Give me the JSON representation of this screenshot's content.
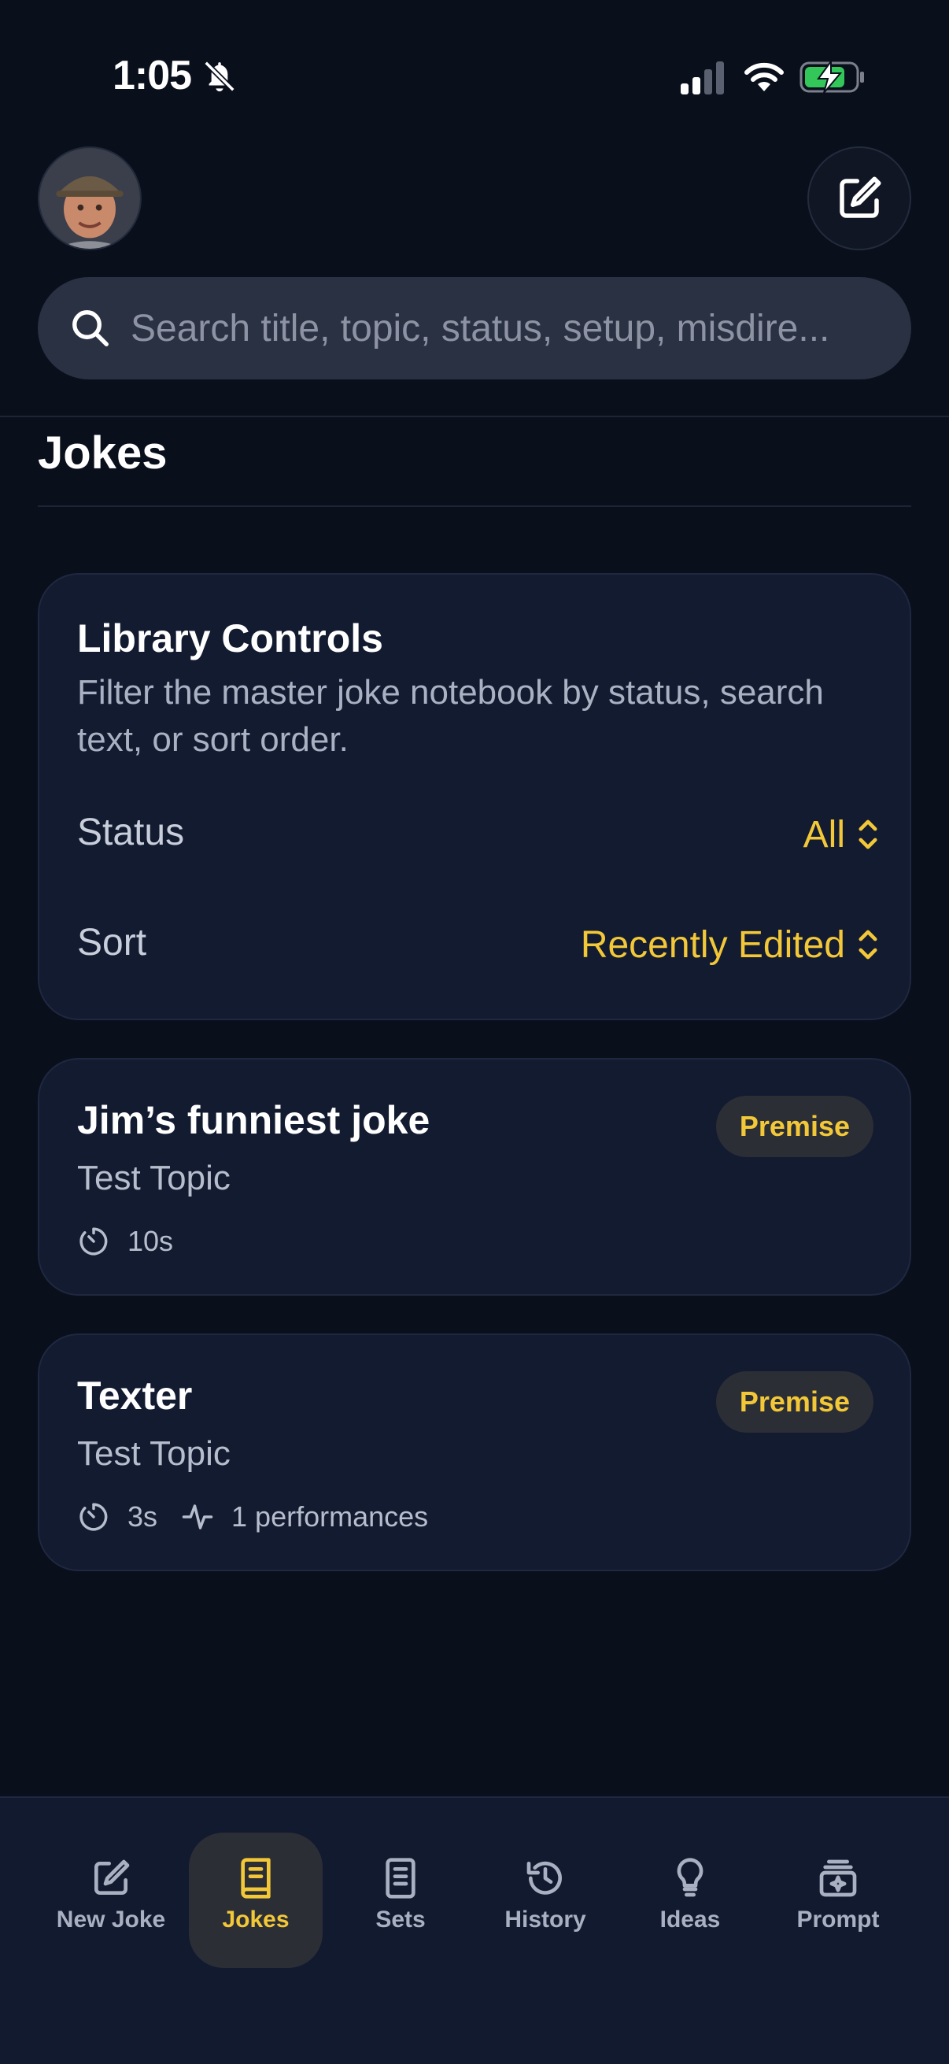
{
  "status_bar": {
    "time": "1:05"
  },
  "header": {
    "avatar_label": "profile-avatar"
  },
  "search": {
    "placeholder": "Search title, topic, status, setup, misdire..."
  },
  "page": {
    "title": "Jokes"
  },
  "library_controls": {
    "title": "Library Controls",
    "description": "Filter the master joke notebook by status, search text, or sort order.",
    "status_label": "Status",
    "status_value": "All",
    "sort_label": "Sort",
    "sort_value": "Recently Edited"
  },
  "jokes": [
    {
      "title": "Jim’s funniest joke",
      "topic": "Test Topic",
      "status": "Premise",
      "duration": "10s",
      "performances": null
    },
    {
      "title": "Texter",
      "topic": "Test Topic",
      "status": "Premise",
      "duration": "3s",
      "performances": "1 performances"
    }
  ],
  "tabs": [
    {
      "label": "New Joke",
      "icon": "compose-icon"
    },
    {
      "label": "Jokes",
      "icon": "book-icon",
      "active": true
    },
    {
      "label": "Sets",
      "icon": "list-doc-icon"
    },
    {
      "label": "History",
      "icon": "history-icon"
    },
    {
      "label": "Ideas",
      "icon": "lightbulb-icon"
    },
    {
      "label": "Prompt",
      "icon": "sparkle-stack-icon"
    }
  ],
  "colors": {
    "accent": "#f3c838",
    "background": "#0a0f1c",
    "card": "#131b31"
  }
}
